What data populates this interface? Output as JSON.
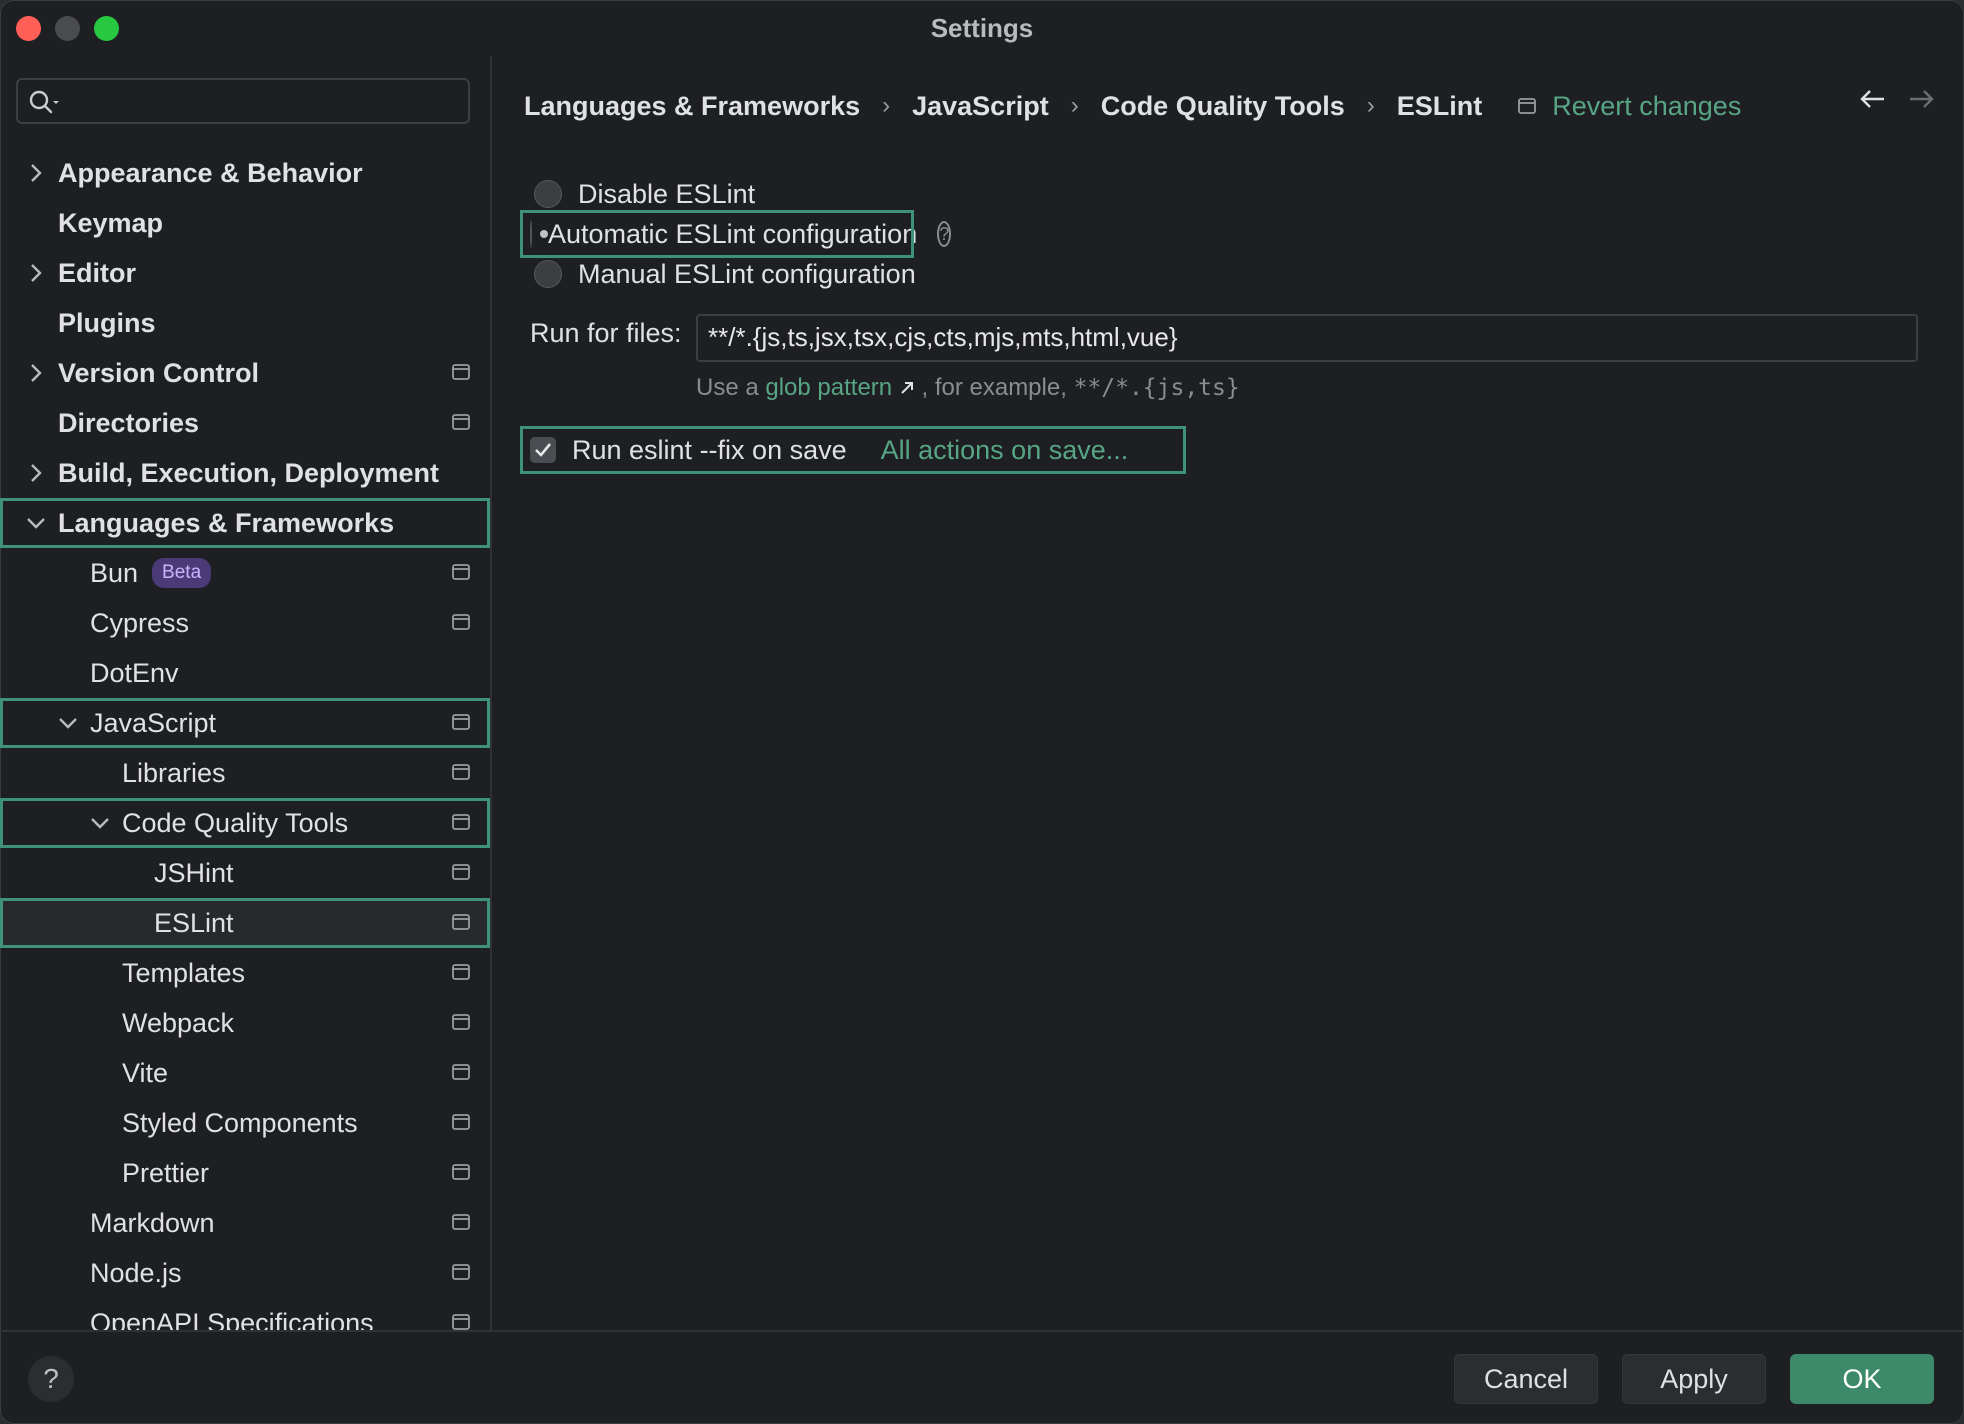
{
  "window": {
    "title": "Settings"
  },
  "search": {
    "placeholder": ""
  },
  "sidebar": {
    "items": [
      {
        "label": "Appearance & Behavior"
      },
      {
        "label": "Keymap"
      },
      {
        "label": "Editor"
      },
      {
        "label": "Plugins"
      },
      {
        "label": "Version Control"
      },
      {
        "label": "Directories"
      },
      {
        "label": "Build, Execution, Deployment"
      },
      {
        "label": "Languages & Frameworks"
      },
      {
        "label": "Bun",
        "badge": "Beta"
      },
      {
        "label": "Cypress"
      },
      {
        "label": "DotEnv"
      },
      {
        "label": "JavaScript"
      },
      {
        "label": "Libraries"
      },
      {
        "label": "Code Quality Tools"
      },
      {
        "label": "JSHint"
      },
      {
        "label": "ESLint"
      },
      {
        "label": "Templates"
      },
      {
        "label": "Webpack"
      },
      {
        "label": "Vite"
      },
      {
        "label": "Styled Components"
      },
      {
        "label": "Prettier"
      },
      {
        "label": "Markdown"
      },
      {
        "label": "Node.js"
      },
      {
        "label": "OpenAPI Specifications"
      }
    ]
  },
  "breadcrumb": {
    "items": [
      "Languages & Frameworks",
      "JavaScript",
      "Code Quality Tools",
      "ESLint"
    ],
    "separator": "›",
    "revert": "Revert changes"
  },
  "eslint": {
    "options": [
      {
        "label": "Disable ESLint",
        "selected": false
      },
      {
        "label": "Automatic ESLint configuration",
        "selected": true
      },
      {
        "label": "Manual ESLint configuration",
        "selected": false
      }
    ],
    "help_glyph": "?",
    "run_for_files_label": "Run for files:",
    "run_for_files_value": "**/*.{js,ts,jsx,tsx,cjs,cts,mjs,mts,html,vue}",
    "hint_prefix": "Use a",
    "hint_link": "glob pattern",
    "hint_middle": ", for example,",
    "hint_example": "**/*.{js,ts}",
    "fix_on_save_label": "Run eslint --fix on save",
    "fix_on_save_checked": true,
    "all_actions_link": "All actions on save..."
  },
  "footer": {
    "help_glyph": "?",
    "cancel": "Cancel",
    "apply": "Apply",
    "ok": "OK"
  },
  "colors": {
    "accent": "#3d8a6b",
    "link": "#57a585",
    "highlight_outline": "#3e9278",
    "background": "#1e1f22",
    "badge_bg": "#4b3a78"
  }
}
